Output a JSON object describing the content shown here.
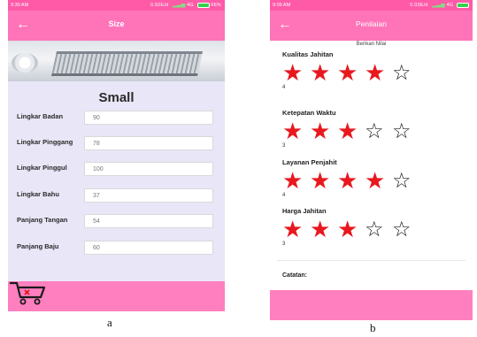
{
  "phone_a": {
    "status": {
      "time": "9:30 AM",
      "network": "0.92E/d",
      "carrier": "4G",
      "battery": "66%"
    },
    "app_bar": {
      "back_icon": "arrow-left-icon",
      "title": "Size"
    },
    "size_heading": "Small",
    "fields": [
      {
        "label": "Lingkar Badan",
        "value": "90"
      },
      {
        "label": "Lingkar Pinggang",
        "value": "78"
      },
      {
        "label": "Lingkar Pinggul",
        "value": "100"
      },
      {
        "label": "Lingkar Bahu",
        "value": "37"
      },
      {
        "label": "Panjang Tangan",
        "value": "54"
      },
      {
        "label": "Panjang Baju",
        "value": "60"
      }
    ],
    "bottom_icon": "shopping-cart-icon",
    "colors": {
      "status_bar": "#ff5aa8",
      "app_bar": "#ff73b8",
      "panel": "#e9e6f8",
      "bottom": "#ff7fbf"
    }
  },
  "phone_b": {
    "status": {
      "time": "9:09 AM",
      "network": "0.03E/d",
      "carrier": "4G"
    },
    "app_bar": {
      "back_icon": "arrow-left-icon",
      "title": "Penilaian"
    },
    "intro": "Berikan Nilai",
    "ratings": [
      {
        "label": "Kualitas Jahitan",
        "value": "4",
        "stars": 4,
        "max": 5
      },
      {
        "label": "Ketepatan Waktu",
        "value": "3",
        "stars": 3,
        "max": 5
      },
      {
        "label": "Layanan Penjahit",
        "value": "4",
        "stars": 4,
        "max": 5
      },
      {
        "label": "Harga Jahitan",
        "value": "3",
        "stars": 3,
        "max": 5
      }
    ],
    "note_label": "Catatan:",
    "colors": {
      "star_filled": "#e8181e",
      "app_bar": "#ff73b8"
    }
  },
  "captions": {
    "a": "a",
    "b": "b"
  }
}
